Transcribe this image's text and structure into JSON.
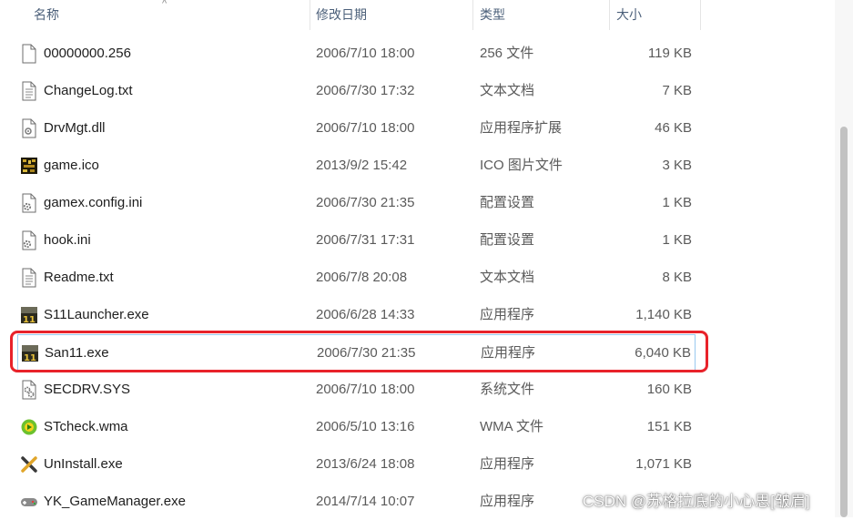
{
  "header": {
    "name": "名称",
    "date": "修改日期",
    "type": "类型",
    "size": "大小",
    "sort_arrow": "^"
  },
  "files": [
    {
      "name": "00000000.256",
      "date": "2006/7/10 18:00",
      "type": "256 文件",
      "size": "119 KB",
      "icon": "generic-file-icon"
    },
    {
      "name": "ChangeLog.txt",
      "date": "2006/7/30 17:32",
      "type": "文本文档",
      "size": "7 KB",
      "icon": "text-file-icon"
    },
    {
      "name": "DrvMgt.dll",
      "date": "2006/7/10 18:00",
      "type": "应用程序扩展",
      "size": "46 KB",
      "icon": "dll-file-icon"
    },
    {
      "name": "game.ico",
      "date": "2013/9/2 15:42",
      "type": "ICO 图片文件",
      "size": "3 KB",
      "icon": "game-ico-icon"
    },
    {
      "name": "gamex.config.ini",
      "date": "2006/7/30 21:35",
      "type": "配置设置",
      "size": "1 KB",
      "icon": "settings-file-icon"
    },
    {
      "name": "hook.ini",
      "date": "2006/7/31 17:31",
      "type": "配置设置",
      "size": "1 KB",
      "icon": "settings-file-icon"
    },
    {
      "name": "Readme.txt",
      "date": "2006/7/8 20:08",
      "type": "文本文档",
      "size": "8 KB",
      "icon": "text-file-icon"
    },
    {
      "name": "S11Launcher.exe",
      "date": "2006/6/28 14:33",
      "type": "应用程序",
      "size": "1,140 KB",
      "icon": "san11-app-icon"
    },
    {
      "name": "San11.exe",
      "date": "2006/7/30 21:35",
      "type": "应用程序",
      "size": "6,040 KB",
      "icon": "san11-app-icon"
    },
    {
      "name": "SECDRV.SYS",
      "date": "2006/7/10 18:00",
      "type": "系统文件",
      "size": "160 KB",
      "icon": "system-file-icon"
    },
    {
      "name": "STcheck.wma",
      "date": "2006/5/10 13:16",
      "type": "WMA 文件",
      "size": "151 KB",
      "icon": "media-file-icon"
    },
    {
      "name": "UnInstall.exe",
      "date": "2013/6/24 18:08",
      "type": "应用程序",
      "size": "1,071 KB",
      "icon": "uninstall-icon"
    },
    {
      "name": "YK_GameManager.exe",
      "date": "2014/7/14 10:07",
      "type": "应用程序",
      "size": "",
      "icon": "gamepad-icon"
    }
  ],
  "watermark": "CSDN @苏格拉底的小心思[皱眉]"
}
